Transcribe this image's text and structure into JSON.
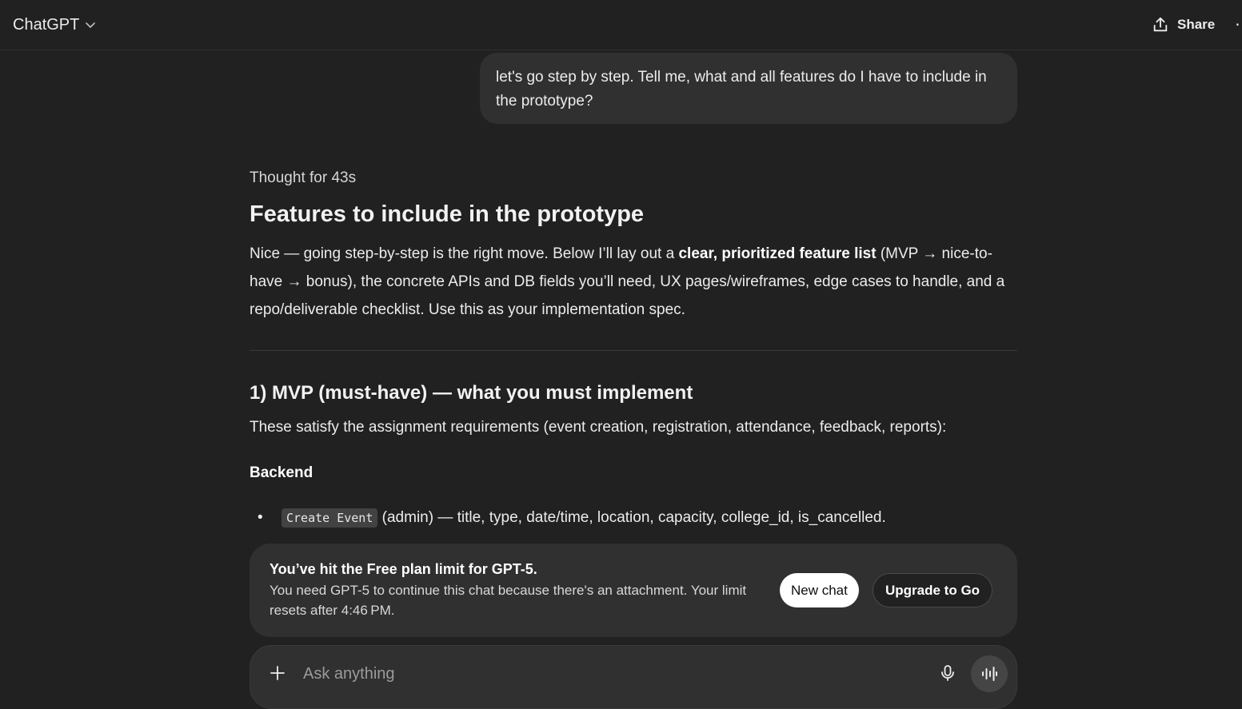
{
  "header": {
    "model_label": "ChatGPT",
    "share_label": "Share"
  },
  "conversation": {
    "user_message": "let's go step by step. Tell me, what and all features do I have to include in the prototype?",
    "thought_label": "Thought for 43s",
    "heading": "Features to include in the prototype",
    "intro": {
      "part1": "Nice — going step-by-step is the right move. Below I’ll lay out a ",
      "bold": "clear, prioritized feature list",
      "part2": " (MVP → nice-to-have → bonus), the concrete APIs and DB fields you’ll need, UX pages/wireframes, edge cases to handle, and a repo/deliverable checklist. Use this as your implementation spec."
    },
    "section_heading": "1) MVP (must-have) — what you must implement",
    "section_text": "These satisfy the assignment requirements (event creation, registration, attendance, feedback, reports):",
    "sub_heading": "Backend",
    "bullets": [
      {
        "code": "Create Event",
        "text": " (admin) — title, type, date/time, location, capacity, college_id, is_cancelled."
      }
    ]
  },
  "limit_notice": {
    "title": "You’ve hit the Free plan limit for GPT-5.",
    "text": "You need GPT-5 to continue this chat because there's an attachment. Your limit resets after 4:46 PM.",
    "new_chat_label": "New chat",
    "upgrade_label": "Upgrade to Go"
  },
  "composer": {
    "placeholder": "Ask anything"
  },
  "icons": {
    "model_dropdown": "chevron-down-icon",
    "share": "share-icon",
    "more": "more-options-icon",
    "plus": "plus-icon",
    "mic": "microphone-icon",
    "voice": "voice-mode-icon"
  }
}
